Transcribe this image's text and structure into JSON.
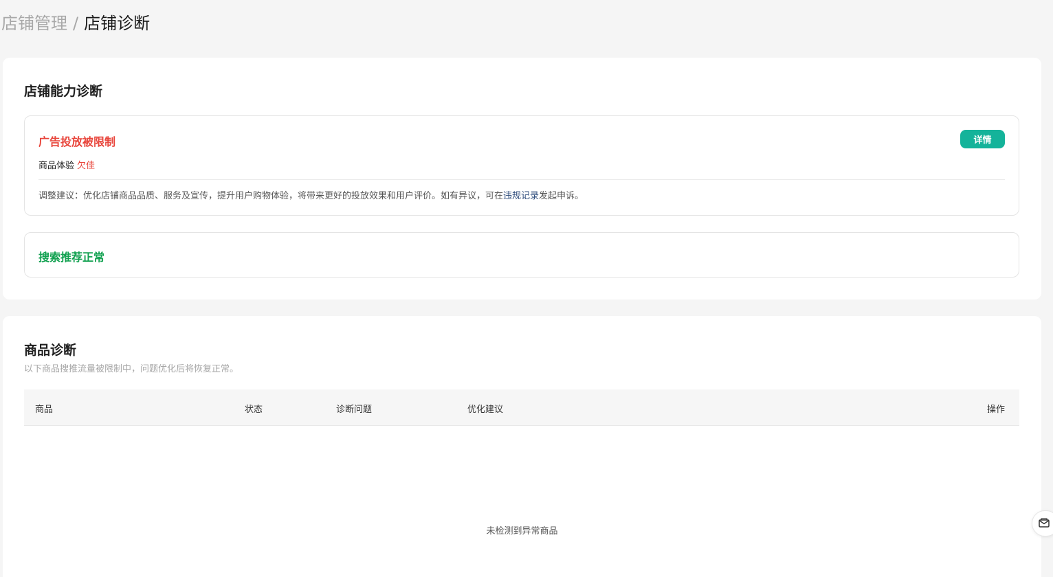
{
  "breadcrumb": {
    "parent": "店铺管理",
    "separator": "/",
    "current": "店铺诊断"
  },
  "store_diagnosis": {
    "title": "店铺能力诊断",
    "ad_status": {
      "title": "广告投放被限制",
      "detail_button": "详情",
      "metric_label": "商品体验",
      "metric_value": "欠佳",
      "advice_prefix": "调整建议：优化店铺商品品质、服务及宣传，提升用户购物体验，将带来更好的投放效果和用户评价。如有异议，可在",
      "advice_link": "违规记录",
      "advice_suffix": "发起申诉。"
    },
    "search_status": {
      "title": "搜索推荐正常"
    }
  },
  "goods_diagnosis": {
    "title": "商品诊断",
    "subtitle": "以下商品搜推流量被限制中，问题优化后将恢复正常。",
    "columns": {
      "goods": "商品",
      "status": "状态",
      "issue": "诊断问题",
      "advice": "优化建议",
      "action": "操作"
    },
    "empty_text": "未检测到异常商品"
  },
  "colors": {
    "warning_red": "#e8443a",
    "ok_green": "#12a150",
    "accent_teal": "#14b39a",
    "link_blue": "#2c4a7a"
  },
  "icons": {
    "float_button": "mail-icon"
  }
}
